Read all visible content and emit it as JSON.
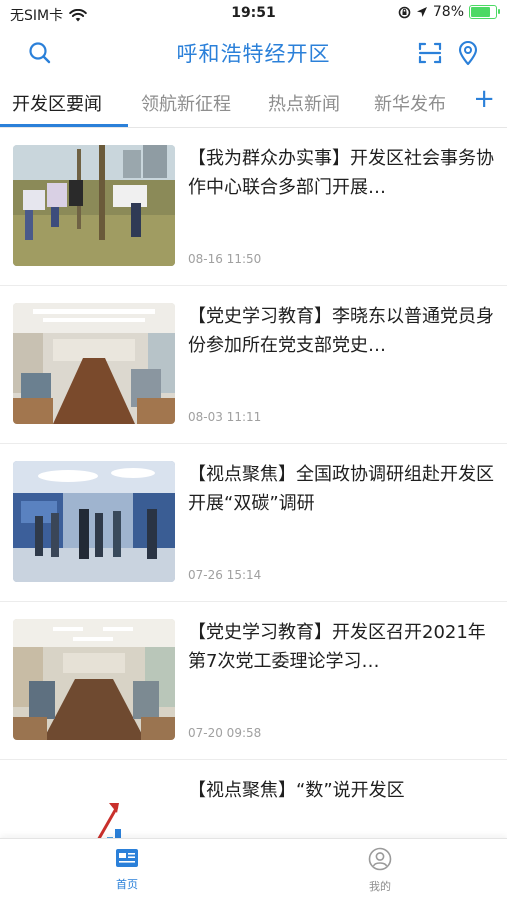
{
  "status_bar": {
    "carrier": "无SIM卡",
    "time": "19:51",
    "battery": "78%",
    "battery_level": 0.78
  },
  "header": {
    "title": "呼和浩特经开区",
    "icons": [
      "search-icon",
      "scan-icon",
      "location-pin-icon"
    ]
  },
  "tabs": [
    {
      "label": "开发区要闻",
      "active": true
    },
    {
      "label": "领航新征程",
      "active": false
    },
    {
      "label": "热点新闻",
      "active": false
    },
    {
      "label": "新华发布",
      "active": false
    }
  ],
  "tabs_add": "+",
  "news": [
    {
      "title": "【我为群众办实事】开发区社会事务协作中心联合多部门开展…",
      "time": "08-16 11:50"
    },
    {
      "title": "【党史学习教育】李晓东以普通党员身份参加所在党支部党史…",
      "time": "08-03 11:11"
    },
    {
      "title": "【视点聚焦】全国政协调研组赴开发区开展“双碳”调研",
      "time": "07-26 15:14"
    },
    {
      "title": "【党史学习教育】开发区召开2021年第7次党工委理论学习…",
      "time": "07-20 09:58"
    },
    {
      "title": "【视点聚焦】“数”说开发区",
      "time": ""
    }
  ],
  "bottom_nav": [
    {
      "label": "首页",
      "active": true,
      "icon": "newspaper-icon"
    },
    {
      "label": "我的",
      "active": false,
      "icon": "user-icon"
    }
  ],
  "colors": {
    "accent": "#2b80d9",
    "inactive_tab": "#8e8e8e",
    "timestamp": "#a0a0a0",
    "battery": "#4cd964"
  }
}
